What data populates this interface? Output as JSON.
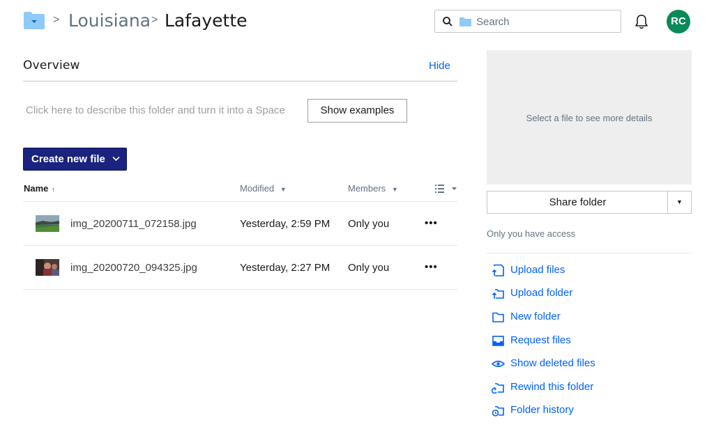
{
  "header": {
    "breadcrumb": [
      "Louisiana",
      "Lafayette"
    ],
    "search_placeholder": "Search",
    "avatar_initials": "RC",
    "avatar_color": "#0a8a58"
  },
  "overview": {
    "title": "Overview",
    "hide_label": "Hide",
    "describe_text": "Click here to describe this folder and turn it into a Space",
    "show_examples_label": "Show examples"
  },
  "toolbar": {
    "create_label": "Create new file"
  },
  "table": {
    "columns": {
      "name": "Name",
      "modified": "Modified",
      "members": "Members"
    },
    "sort_arrow": "↑",
    "rows": [
      {
        "name": "img_20200711_072158.jpg",
        "modified": "Yesterday, 2:59 PM",
        "members": "Only you",
        "more": "•••"
      },
      {
        "name": "img_20200720_094325.jpg",
        "modified": "Yesterday, 2:27 PM",
        "members": "Only you",
        "more": "•••"
      }
    ]
  },
  "panel": {
    "preview_text": "Select a file to see more details",
    "share_label": "Share folder",
    "share_dropdown": "▼",
    "access_text": "Only you have access",
    "actions": [
      {
        "label": "Upload files",
        "icon": "upload-files-icon"
      },
      {
        "label": "Upload folder",
        "icon": "upload-folder-icon"
      },
      {
        "label": "New folder",
        "icon": "new-folder-icon"
      },
      {
        "label": "Request files",
        "icon": "request-files-icon"
      },
      {
        "label": "Show deleted files",
        "icon": "eye-icon"
      },
      {
        "label": "Rewind this folder",
        "icon": "rewind-icon"
      },
      {
        "label": "Folder history",
        "icon": "history-icon"
      }
    ]
  },
  "colors": {
    "accent": "#0061fe",
    "create_button": "#1a237e",
    "folder": "#90caf9"
  }
}
